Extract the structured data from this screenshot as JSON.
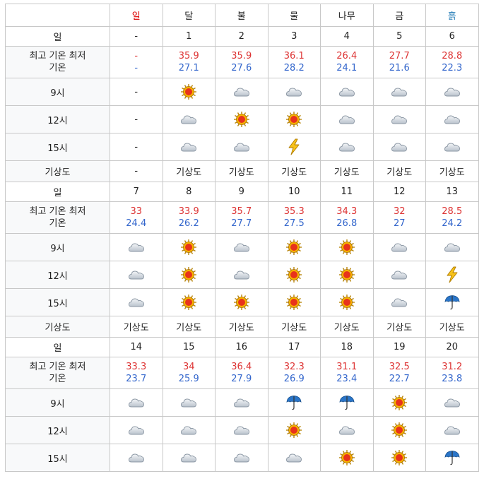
{
  "header": {
    "days": [
      {
        "label": "일",
        "color": "#dd0000"
      },
      {
        "label": "달",
        "color": "#222222"
      },
      {
        "label": "불",
        "color": "#222222"
      },
      {
        "label": "물",
        "color": "#222222"
      },
      {
        "label": "나무",
        "color": "#222222"
      },
      {
        "label": "금",
        "color": "#222222"
      },
      {
        "label": "흙",
        "color": "#2a7fb8"
      }
    ]
  },
  "labels": {
    "day": "일",
    "temp_line1": "최고 기온 최저",
    "temp_line2": "기온",
    "t9": "9시",
    "t12": "12시",
    "t15": "15시",
    "map": "기상도"
  },
  "weeks": [
    {
      "dates": [
        "-",
        "1",
        "2",
        "3",
        "4",
        "5",
        "6"
      ],
      "high": [
        "-",
        "35.9",
        "35.9",
        "36.1",
        "26.4",
        "27.7",
        "28.8"
      ],
      "low": [
        "-",
        "27.1",
        "27.6",
        "28.2",
        "24.1",
        "21.6",
        "22.3"
      ],
      "t9": [
        "dash",
        "sun",
        "cloud",
        "cloud",
        "cloud",
        "cloud",
        "cloud"
      ],
      "t12": [
        "dash",
        "cloud",
        "sun",
        "sun",
        "cloud",
        "cloud",
        "cloud"
      ],
      "t15": [
        "dash",
        "cloud",
        "cloud",
        "thunder",
        "cloud",
        "cloud",
        "cloud"
      ],
      "map": [
        "-",
        "기상도",
        "기상도",
        "기상도",
        "기상도",
        "기상도",
        "기상도"
      ]
    },
    {
      "dates": [
        "7",
        "8",
        "9",
        "10",
        "11",
        "12",
        "13"
      ],
      "high": [
        "33",
        "33.9",
        "35.7",
        "35.3",
        "34.3",
        "32",
        "28.5"
      ],
      "low": [
        "24.4",
        "26.2",
        "27.7",
        "27.5",
        "26.8",
        "27",
        "24.2"
      ],
      "t9": [
        "cloud",
        "sun",
        "cloud",
        "sun",
        "sun",
        "cloud",
        "cloud"
      ],
      "t12": [
        "cloud",
        "sun",
        "cloud",
        "sun",
        "sun",
        "cloud",
        "thunder"
      ],
      "t15": [
        "cloud",
        "sun",
        "sun",
        "sun",
        "sun",
        "cloud",
        "umbrella"
      ],
      "map": [
        "기상도",
        "기상도",
        "기상도",
        "기상도",
        "기상도",
        "기상도",
        "기상도"
      ]
    },
    {
      "dates": [
        "14",
        "15",
        "16",
        "17",
        "18",
        "19",
        "20"
      ],
      "high": [
        "33.3",
        "34",
        "36.4",
        "32.3",
        "31.1",
        "32.5",
        "31.2"
      ],
      "low": [
        "23.7",
        "25.9",
        "27.9",
        "26.9",
        "23.4",
        "22.7",
        "23.8"
      ],
      "t9": [
        "cloud",
        "cloud",
        "cloud",
        "umbrella",
        "umbrella",
        "sun",
        "cloud"
      ],
      "t12": [
        "cloud",
        "cloud",
        "cloud",
        "sun",
        "cloud",
        "sun",
        "cloud"
      ],
      "t15": [
        "cloud",
        "cloud",
        "cloud",
        "cloud",
        "sun",
        "sun",
        "umbrella"
      ]
    }
  ],
  "colors": {
    "high": "#dd3333",
    "low": "#3366cc",
    "map_link": "#333333"
  }
}
